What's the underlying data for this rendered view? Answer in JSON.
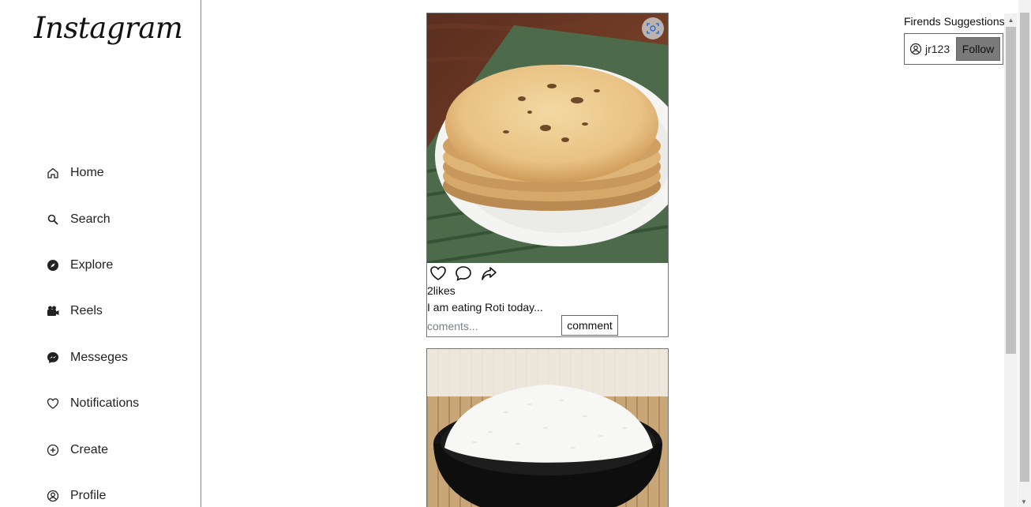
{
  "sidebar": {
    "logo": "Instagram",
    "items": [
      {
        "label": "Home",
        "icon": "home-icon"
      },
      {
        "label": "Search",
        "icon": "search-icon"
      },
      {
        "label": "Explore",
        "icon": "compass-icon"
      },
      {
        "label": "Reels",
        "icon": "video-camera-icon"
      },
      {
        "label": "Messeges",
        "icon": "messenger-icon"
      },
      {
        "label": "Notifications",
        "icon": "heart-icon"
      },
      {
        "label": "Create",
        "icon": "plus-circle-icon"
      },
      {
        "label": "Profile",
        "icon": "user-circle-icon"
      }
    ]
  },
  "feed": {
    "posts": [
      {
        "image": "roti-photo",
        "likes": "2likes",
        "caption": "I am eating Roti today...",
        "comment_placeholder": "coments...",
        "comment_button": "comment"
      },
      {
        "image": "rice-bowl-photo"
      }
    ]
  },
  "suggestions": {
    "title": "Firends Suggestions",
    "users": [
      {
        "username": "jr123",
        "follow_label": "Follow"
      }
    ]
  }
}
